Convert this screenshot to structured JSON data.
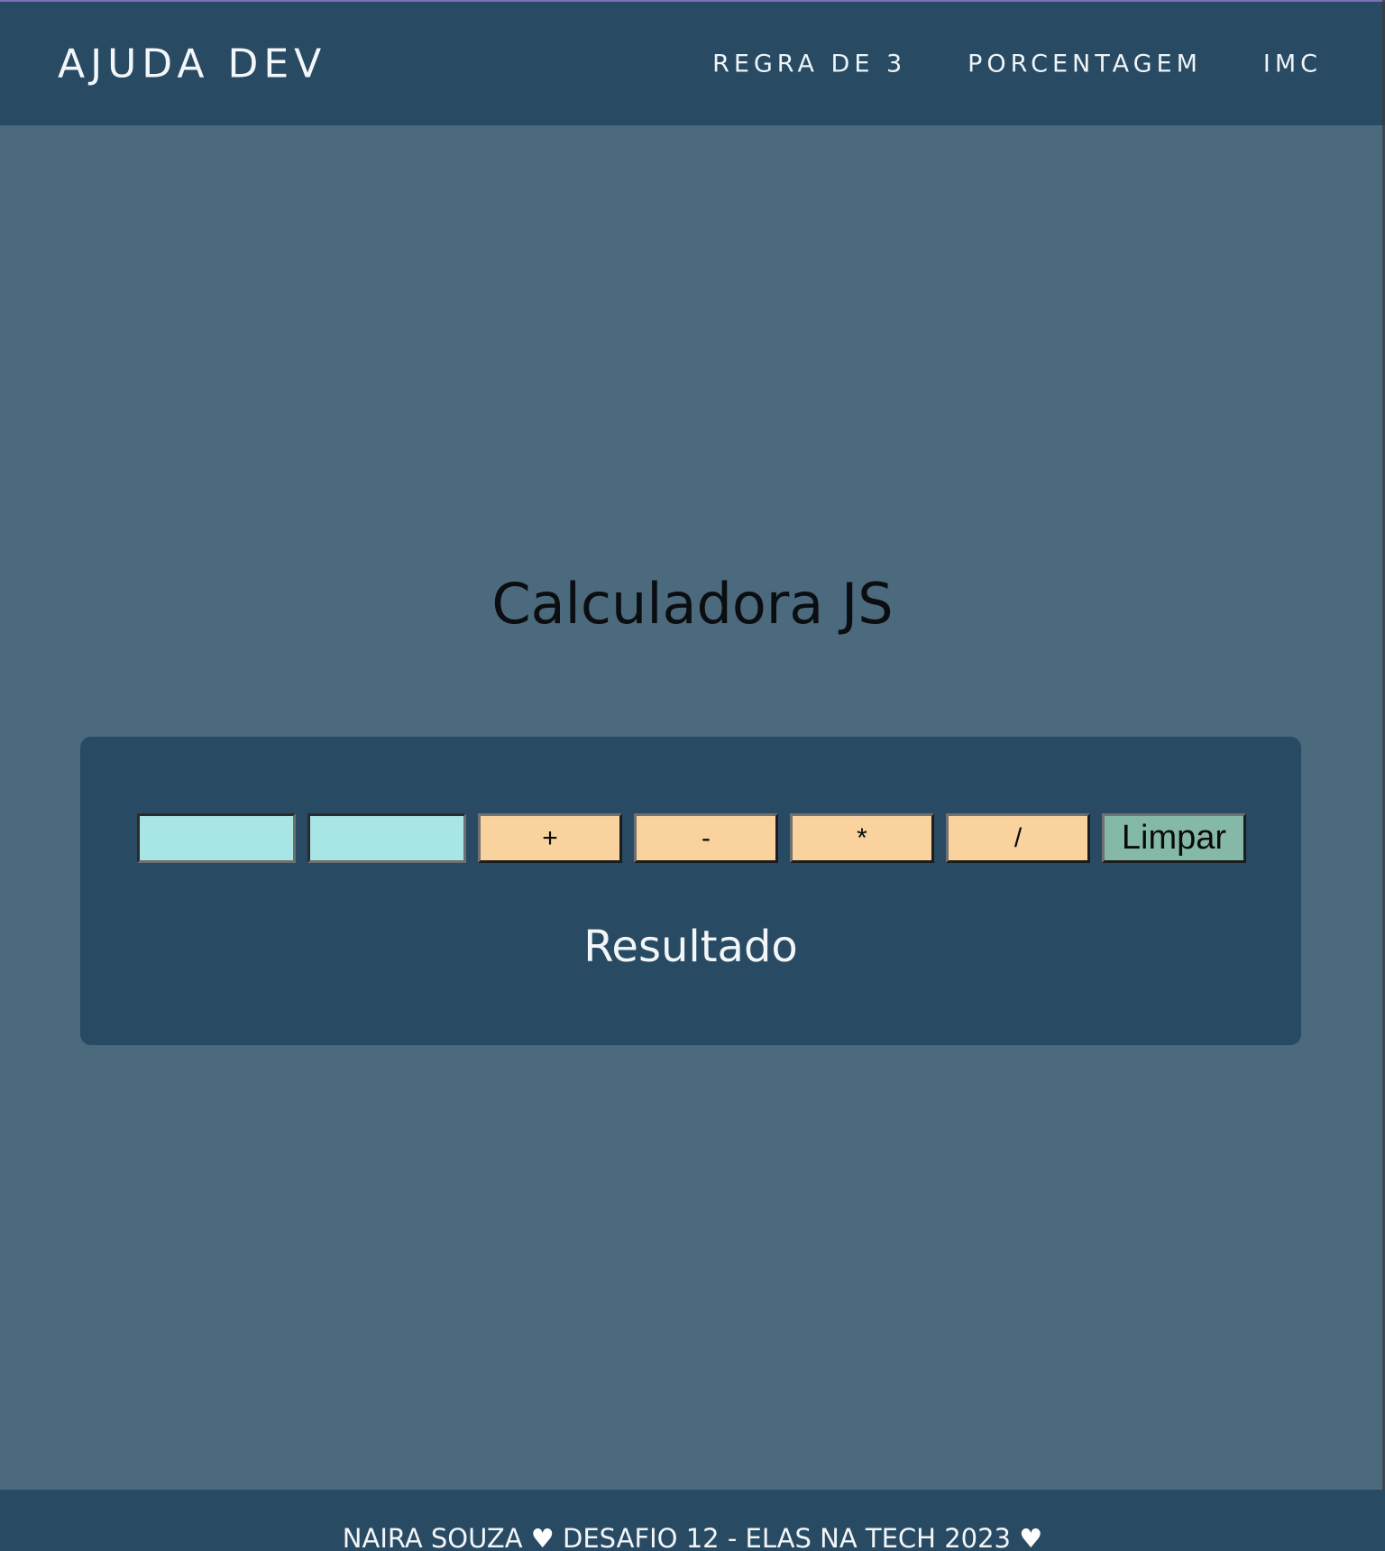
{
  "header": {
    "brand": "AJUDA DEV",
    "nav": [
      {
        "label": "REGRA DE 3"
      },
      {
        "label": "PORCENTAGEM"
      },
      {
        "label": "IMC"
      }
    ]
  },
  "main": {
    "title": "Calculadora JS",
    "calculator": {
      "input1_value": "",
      "input2_value": "",
      "ops": [
        "+",
        "-",
        "*",
        "/"
      ],
      "clear_label": "Limpar",
      "result": "Resultado"
    }
  },
  "footer": {
    "text_part1": "NAIRA SOUZA",
    "heart1": "♥",
    "text_part2": "DESAFIO 12 - ELAS NA TECH 2023",
    "heart2": "♥",
    "heart_icon": "heart-icon"
  },
  "colors": {
    "navbar": "#284b63",
    "background": "#4b6a7d",
    "input": "#a8e6e6",
    "op_button": "#f9d29e",
    "clear_button": "#84b8a7"
  }
}
